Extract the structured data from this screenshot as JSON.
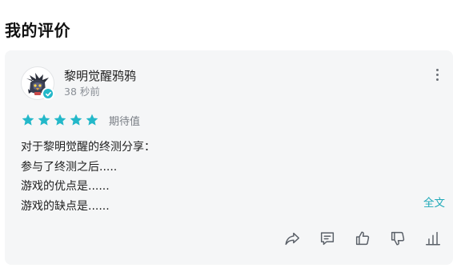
{
  "section": {
    "title": "我的评价"
  },
  "review": {
    "user": {
      "name": "黎明觉醒鸦鸦",
      "avatar_icon": "crow-mascot-avatar",
      "verified_badge_icon": "verified-check-badge"
    },
    "time": "38 秒前",
    "rating": {
      "stars": 5,
      "max_stars": 5,
      "label": "期待值",
      "star_color": "#23b8c9"
    },
    "lines": [
      "对于黎明觉醒的终测分享：",
      "参与了终测之后.....",
      "游戏的优点是......",
      "游戏的缺点是......"
    ],
    "expand_label": "全文",
    "accent_color": "#1fa9b8"
  },
  "actions": [
    {
      "name": "share",
      "icon": "share-arrow-icon"
    },
    {
      "name": "comment",
      "icon": "comment-icon"
    },
    {
      "name": "like",
      "icon": "thumbs-up-icon"
    },
    {
      "name": "dislike",
      "icon": "thumbs-down-icon"
    },
    {
      "name": "stats",
      "icon": "bar-chart-icon"
    }
  ],
  "more_menu_icon": "more-vertical-icon"
}
